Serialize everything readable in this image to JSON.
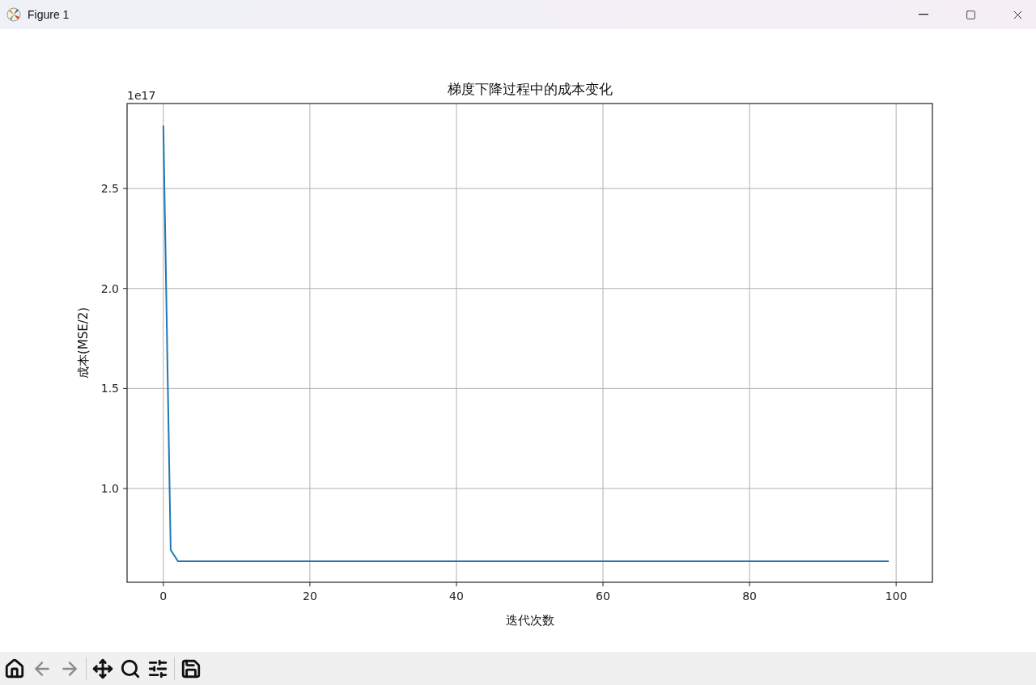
{
  "window": {
    "title": "Figure 1"
  },
  "figure": {
    "chart_data": {
      "type": "line",
      "title": "梯度下降过程中的成本变化",
      "xlabel": "迭代次数",
      "ylabel": "成本(MSE/2)",
      "xlim": [
        -4.95,
        104.95
      ],
      "ylim": [
        0.531,
        2.925
      ],
      "xticks": [
        0,
        20,
        40,
        60,
        80,
        100
      ],
      "yticks": [
        {
          "value": 1.0,
          "label": "1.0"
        },
        {
          "value": 1.5,
          "label": "1.5"
        },
        {
          "value": 2.0,
          "label": "2.0"
        },
        {
          "value": 2.5,
          "label": "2.5"
        }
      ],
      "annotations": [
        {
          "text": "1e17"
        }
      ],
      "grid": true,
      "x": [
        0,
        1,
        2,
        3,
        4,
        5,
        6,
        7,
        8,
        9,
        10,
        11,
        12,
        13,
        14,
        15,
        16,
        17,
        18,
        19,
        20,
        21,
        22,
        23,
        24,
        25,
        26,
        27,
        28,
        29,
        30,
        31,
        32,
        33,
        34,
        35,
        36,
        37,
        38,
        39,
        40,
        41,
        42,
        43,
        44,
        45,
        46,
        47,
        48,
        49,
        50,
        51,
        52,
        53,
        54,
        55,
        56,
        57,
        58,
        59,
        60,
        61,
        62,
        63,
        64,
        65,
        66,
        67,
        68,
        69,
        70,
        71,
        72,
        73,
        74,
        75,
        76,
        77,
        78,
        79,
        80,
        81,
        82,
        83,
        84,
        85,
        86,
        87,
        88,
        89,
        90,
        91,
        92,
        93,
        94,
        95,
        96,
        97,
        98,
        99
      ],
      "series": [
        {
          "color": "#1f77b4",
          "values": [
            2.815,
            0.693,
            0.636,
            0.636,
            0.636,
            0.636,
            0.636,
            0.636,
            0.636,
            0.636,
            0.636,
            0.636,
            0.636,
            0.636,
            0.636,
            0.636,
            0.636,
            0.636,
            0.636,
            0.636,
            0.636,
            0.636,
            0.636,
            0.636,
            0.636,
            0.636,
            0.636,
            0.636,
            0.636,
            0.636,
            0.636,
            0.636,
            0.636,
            0.636,
            0.636,
            0.636,
            0.636,
            0.636,
            0.636,
            0.636,
            0.636,
            0.636,
            0.636,
            0.636,
            0.636,
            0.636,
            0.636,
            0.636,
            0.636,
            0.636,
            0.636,
            0.636,
            0.636,
            0.636,
            0.636,
            0.636,
            0.636,
            0.636,
            0.636,
            0.636,
            0.636,
            0.636,
            0.636,
            0.636,
            0.636,
            0.636,
            0.636,
            0.636,
            0.636,
            0.636,
            0.636,
            0.636,
            0.636,
            0.636,
            0.636,
            0.636,
            0.636,
            0.636,
            0.636,
            0.636,
            0.636,
            0.636,
            0.636,
            0.636,
            0.636,
            0.636,
            0.636,
            0.636,
            0.636,
            0.636,
            0.636,
            0.636,
            0.636,
            0.636,
            0.636,
            0.636,
            0.636,
            0.636,
            0.636,
            0.636
          ]
        }
      ]
    }
  },
  "toolbar": [
    {
      "kind": "home",
      "disabled": false
    },
    {
      "kind": "back",
      "disabled": true
    },
    {
      "kind": "forward",
      "disabled": true
    },
    {
      "kind": "separator"
    },
    {
      "kind": "pan",
      "disabled": false
    },
    {
      "kind": "zoom",
      "disabled": false
    },
    {
      "kind": "configure",
      "disabled": false
    },
    {
      "kind": "separator"
    },
    {
      "kind": "save",
      "disabled": false
    }
  ]
}
